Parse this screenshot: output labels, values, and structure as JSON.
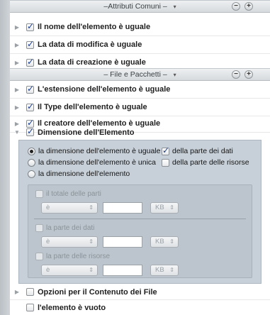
{
  "sections": [
    {
      "title": "–Attributi Comuni –",
      "rows": [
        {
          "label": "Il nome dell'elemento è uguale",
          "checked": true
        },
        {
          "label": "La data di modifica è uguale",
          "checked": true
        },
        {
          "label": "La data di creazione è uguale",
          "checked": true
        }
      ]
    },
    {
      "title": "– File e Pacchetti –",
      "rows": [
        {
          "label": "L'estensione dell'elemento è uguale",
          "checked": true
        },
        {
          "label": "Il Type dell'elemento è uguale",
          "checked": true
        },
        {
          "label": "Il creatore dell'elemento è uguale",
          "checked": true
        },
        {
          "label": "Dimensione dell'Elemento",
          "checked": true,
          "expanded": true
        }
      ]
    }
  ],
  "size_options": {
    "radios": [
      {
        "label": "la dimensione dell'elemento è uguale",
        "selected": true
      },
      {
        "label": "la dimensione dell'elemento è unica",
        "selected": false
      },
      {
        "label": "la dimensione dell'elemento",
        "selected": false
      }
    ],
    "checks": [
      {
        "label": "della parte dei dati",
        "checked": true
      },
      {
        "label": "della parte delle risorse",
        "checked": false
      }
    ],
    "groups": [
      {
        "label": "il totale delle parti",
        "operator": "è",
        "unit": "KB"
      },
      {
        "label": "la parte dei dati",
        "operator": "è",
        "unit": "KB"
      },
      {
        "label": "la parte delle risorse",
        "operator": "è",
        "unit": "KB"
      }
    ]
  },
  "bottom_rows": [
    {
      "label": "Opzioni per il Contenuto dei File",
      "checked": false
    },
    {
      "label": "l'elemento è vuoto",
      "checked": false
    }
  ],
  "icons": {
    "minus": "−",
    "plus": "+",
    "caret": "▾",
    "disclosure_closed": "▶",
    "disclosure_open": "▼",
    "popup_arrows": "⇕"
  }
}
